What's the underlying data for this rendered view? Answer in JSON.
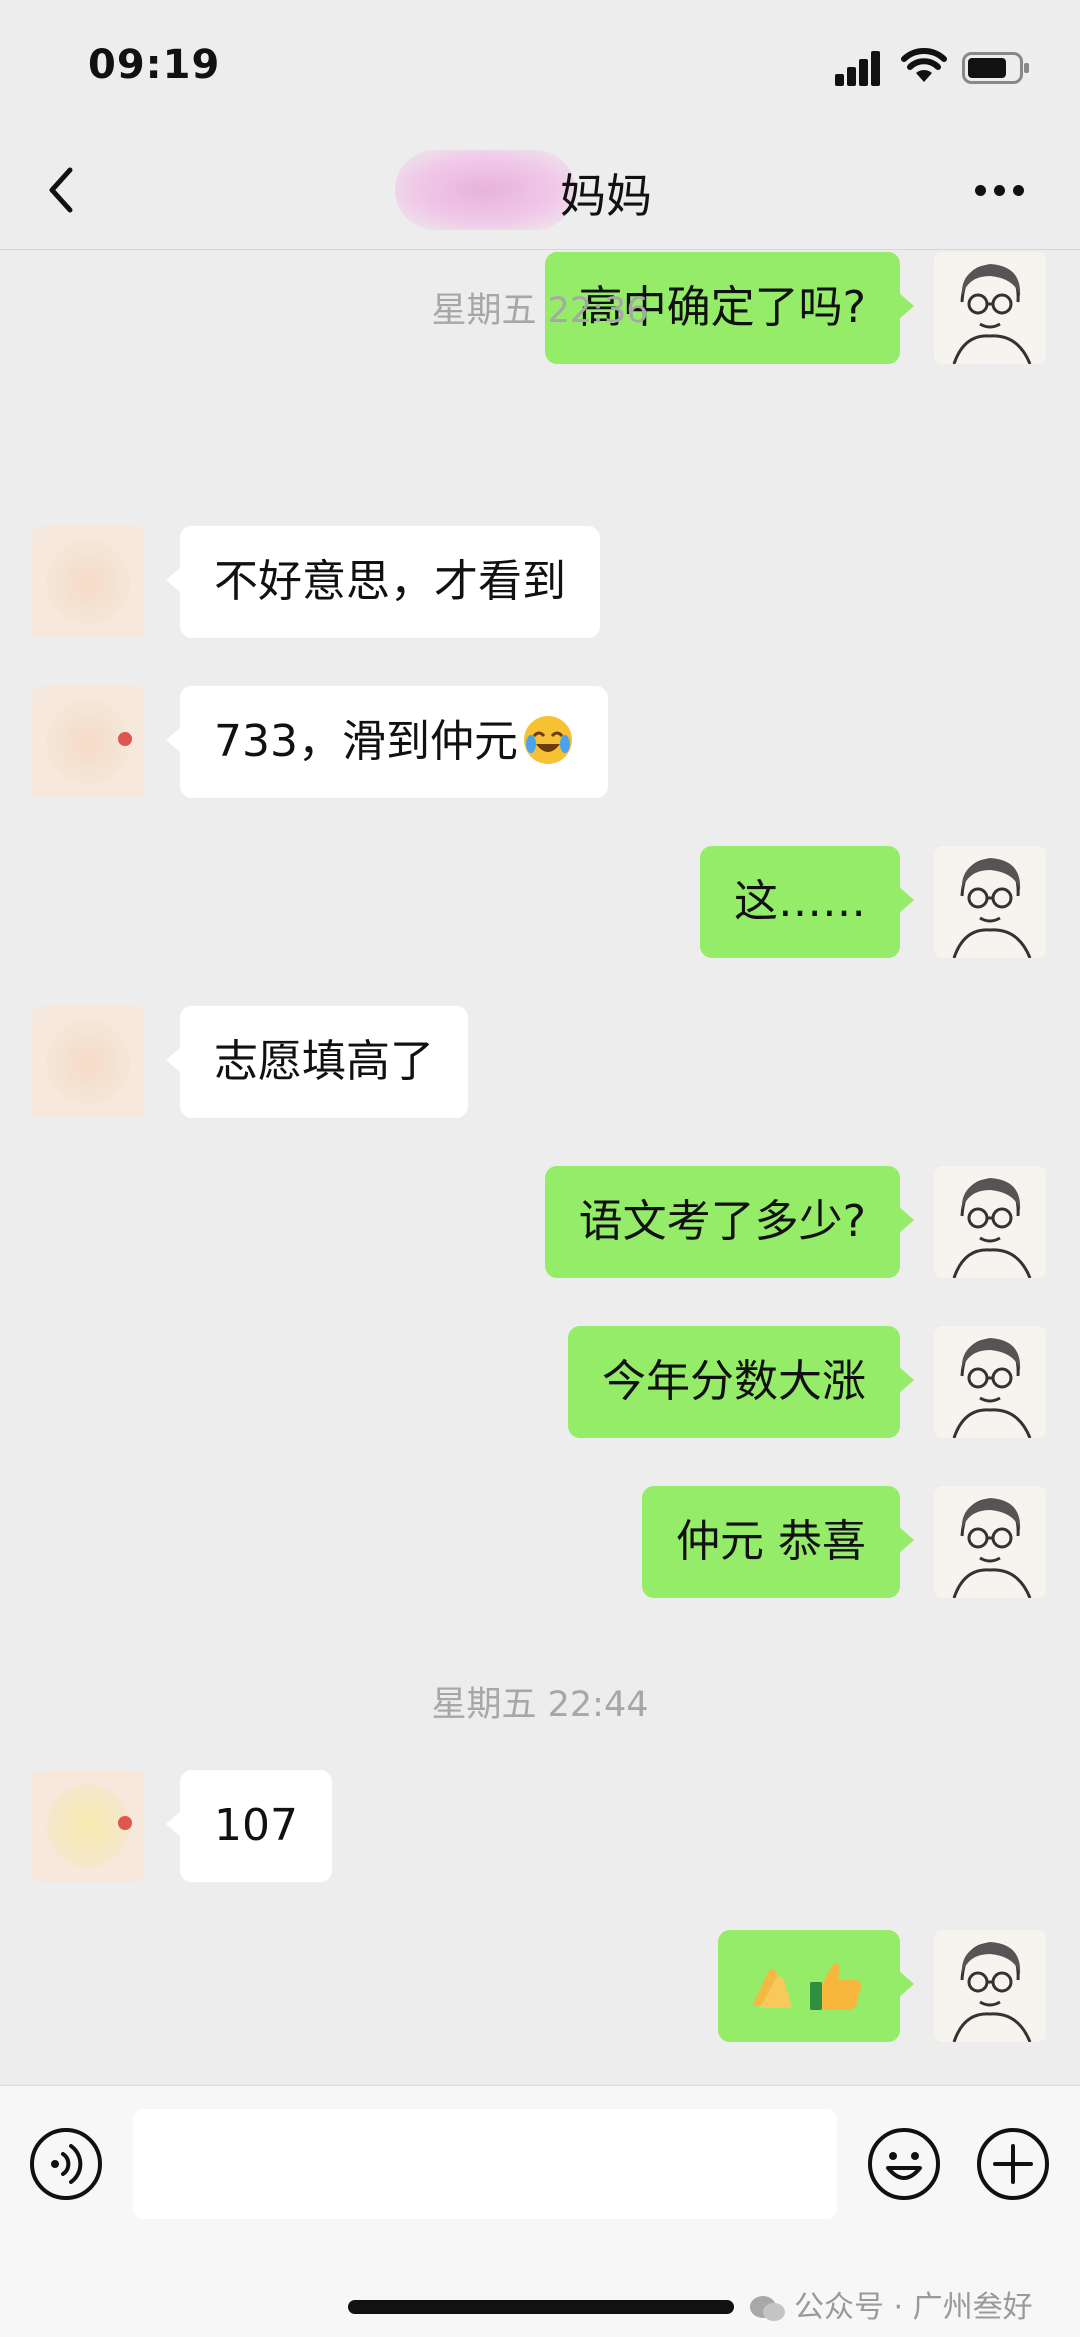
{
  "status_bar": {
    "time": "09:19"
  },
  "nav": {
    "title": "妈妈"
  },
  "messages": [
    {
      "side": "out",
      "text": "高中确定了吗?"
    },
    {
      "side": "time",
      "text": "星期五 22:36"
    },
    {
      "side": "in",
      "text": "不好意思，才看到"
    },
    {
      "side": "in",
      "text": "733，滑到仲元",
      "emoji": "crying-laughing-face"
    },
    {
      "side": "out",
      "text": "这……"
    },
    {
      "side": "in",
      "text": "志愿填高了"
    },
    {
      "side": "out",
      "text": "语文考了多少?"
    },
    {
      "side": "out",
      "text": "今年分数大涨"
    },
    {
      "side": "out",
      "text": "仲元 恭喜"
    },
    {
      "side": "time",
      "text": "星期五 22:44"
    },
    {
      "side": "in",
      "text": "107"
    },
    {
      "side": "out",
      "text": "",
      "emoji": "clap-and-thumbs-up"
    }
  ],
  "input_bar": {
    "value": ""
  },
  "watermark": {
    "text": "公众号 · 广州叁好"
  },
  "icons": {
    "back": "chevron-left-icon",
    "more": "ellipsis-icon",
    "voice": "voice-icon",
    "emoji": "smiley-icon",
    "plus": "plus-icon"
  },
  "colors": {
    "sent_bubble": "#95ec69",
    "received_bubble": "#ffffff",
    "background": "#ededed"
  }
}
